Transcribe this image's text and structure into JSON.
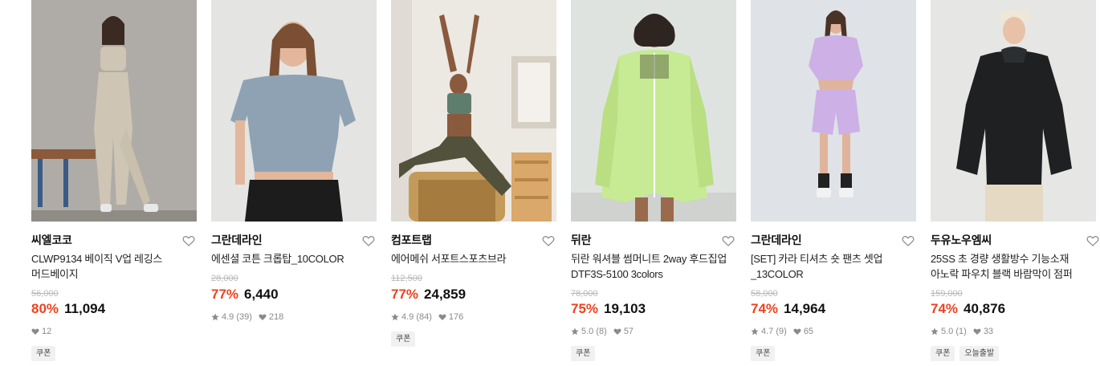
{
  "products": [
    {
      "brand": "씨엘코코",
      "name_line1": "CLWP9134 베이직 V업 레깅스",
      "name_line2": "머드베이지",
      "original_price": "56,000",
      "discount": "80%",
      "price": "11,094",
      "rating": "",
      "reviews": "",
      "likes": "12",
      "tags": [
        "쿠폰"
      ]
    },
    {
      "brand": "그란데라인",
      "name_line1": "에센셜 코튼 크롭탑_10COLOR",
      "name_line2": "",
      "original_price": "28,000",
      "discount": "77%",
      "price": "6,440",
      "rating": "4.9",
      "reviews": "(39)",
      "likes": "218",
      "tags": []
    },
    {
      "brand": "컴포트랩",
      "name_line1": "에어메쉬 서포트스포츠브라",
      "name_line2": "",
      "original_price": "112,500",
      "discount": "77%",
      "price": "24,859",
      "rating": "4.9",
      "reviews": "(84)",
      "likes": "176",
      "tags": [
        "쿠폰"
      ]
    },
    {
      "brand": "뒤란",
      "name_line1": "뒤란 워셔블 썸머니트 2way 후드집업",
      "name_line2": "DTF3S-5100 3colors",
      "original_price": "78,000",
      "discount": "75%",
      "price": "19,103",
      "rating": "5.0",
      "reviews": "(8)",
      "likes": "57",
      "tags": [
        "쿠폰"
      ]
    },
    {
      "brand": "그란데라인",
      "name_line1": "[SET] 카라 티셔츠 숏 팬츠 셋업",
      "name_line2": "_13COLOR",
      "original_price": "58,000",
      "discount": "74%",
      "price": "14,964",
      "rating": "4.7",
      "reviews": "(9)",
      "likes": "65",
      "tags": [
        "쿠폰"
      ]
    },
    {
      "brand": "두유노우엠씨",
      "name_line1": "25SS 초 경량 생활방수 기능소재",
      "name_line2": "아노락 파우치 블랙 바람막이 점퍼",
      "original_price": "159,000",
      "discount": "74%",
      "price": "40,876",
      "rating": "5.0",
      "reviews": "(1)",
      "likes": "33",
      "tags": [
        "쿠폰",
        "오늘출발"
      ]
    }
  ],
  "colors": {
    "discount": "#f0411e",
    "original_price": "#b8b8b8",
    "meta": "#8a8a8a",
    "tag_bg": "#f1f1f1"
  },
  "icons": {
    "wishlist": "heart-outline-icon",
    "rating": "star-icon",
    "likes": "heart-filled-icon"
  }
}
